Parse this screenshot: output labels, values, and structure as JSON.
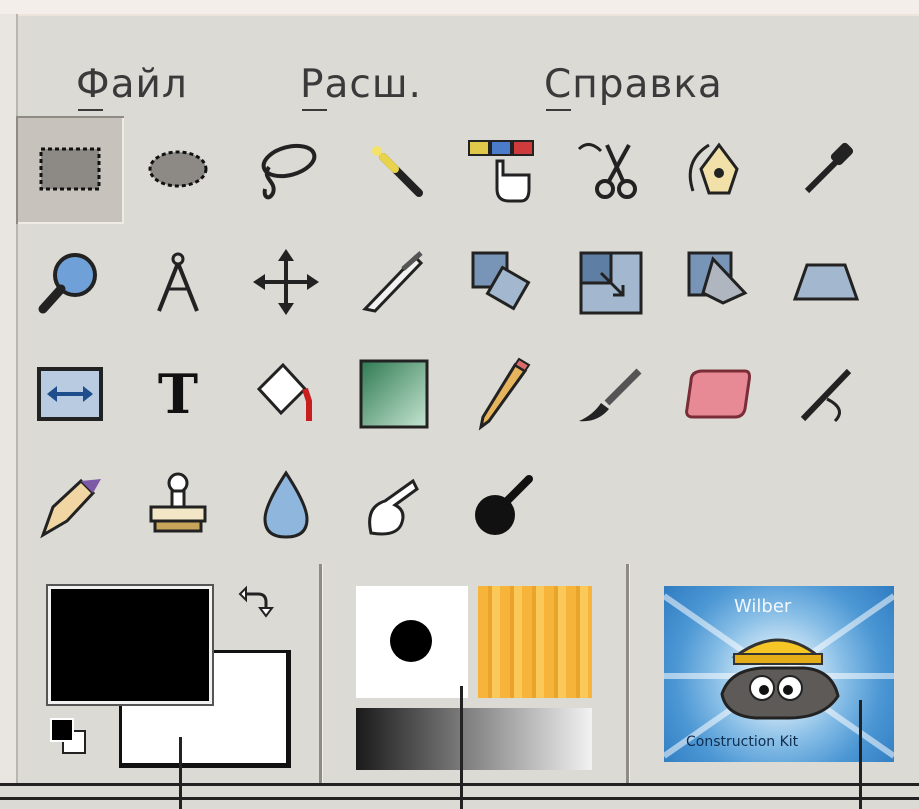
{
  "menu": {
    "file": "Файл",
    "extensions": "Расш.",
    "help": "Справка"
  },
  "tools": [
    {
      "name": "rect-select",
      "icon": "rect-select-icon",
      "selected": true
    },
    {
      "name": "ellipse-select",
      "icon": "ellipse-select-icon"
    },
    {
      "name": "free-select",
      "icon": "lasso-icon"
    },
    {
      "name": "fuzzy-select",
      "icon": "magic-wand-icon"
    },
    {
      "name": "select-by-color",
      "icon": "color-select-icon"
    },
    {
      "name": "scissors-select",
      "icon": "scissors-icon"
    },
    {
      "name": "foreground-select",
      "icon": "foreground-select-icon"
    },
    {
      "name": "color-picker",
      "icon": "eyedropper-icon"
    },
    {
      "name": "zoom",
      "icon": "magnifier-icon"
    },
    {
      "name": "measure",
      "icon": "compass-icon"
    },
    {
      "name": "move",
      "icon": "move-icon"
    },
    {
      "name": "crop",
      "icon": "knife-icon"
    },
    {
      "name": "rotate",
      "icon": "rotate-icon"
    },
    {
      "name": "scale",
      "icon": "scale-icon"
    },
    {
      "name": "shear",
      "icon": "shear-icon"
    },
    {
      "name": "perspective",
      "icon": "perspective-icon"
    },
    {
      "name": "flip",
      "icon": "flip-icon"
    },
    {
      "name": "text",
      "icon": "text-icon",
      "glyph": "T"
    },
    {
      "name": "bucket-fill",
      "icon": "bucket-icon"
    },
    {
      "name": "blend",
      "icon": "gradient-icon"
    },
    {
      "name": "pencil",
      "icon": "pencil-icon"
    },
    {
      "name": "paintbrush",
      "icon": "paintbrush-icon"
    },
    {
      "name": "eraser",
      "icon": "eraser-icon"
    },
    {
      "name": "airbrush",
      "icon": "airbrush-icon"
    },
    {
      "name": "ink",
      "icon": "ink-pen-icon"
    },
    {
      "name": "clone",
      "icon": "stamp-icon"
    },
    {
      "name": "blur-sharpen",
      "icon": "drop-icon"
    },
    {
      "name": "smudge",
      "icon": "smudge-icon"
    },
    {
      "name": "dodge-burn",
      "icon": "dodge-burn-icon"
    }
  ],
  "colors": {
    "foreground": "#000000",
    "background": "#ffffff",
    "gradient_start": "#1a1a1a",
    "gradient_end": "#f2f2f2",
    "pattern": "#f7b43b"
  },
  "image_thumbnail": {
    "top_text": "Wilber",
    "bottom_text": "Construction Kit"
  }
}
